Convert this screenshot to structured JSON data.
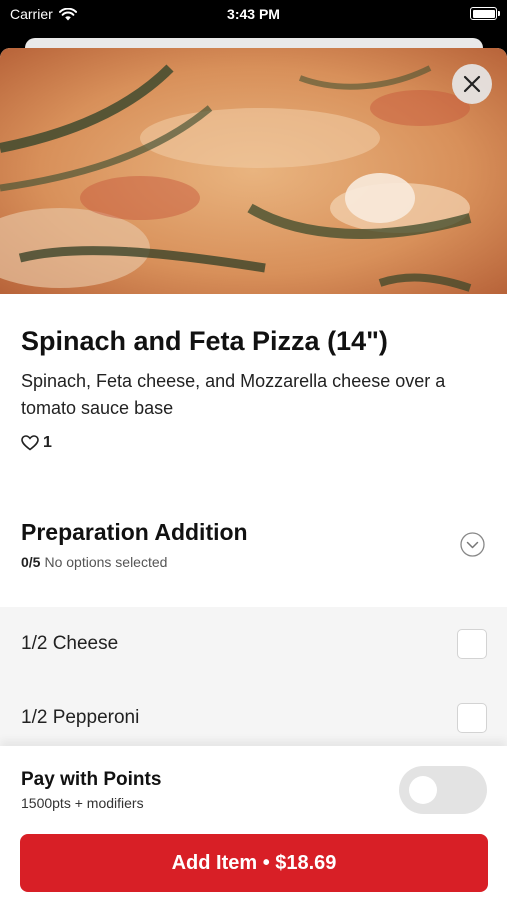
{
  "status_bar": {
    "carrier": "Carrier",
    "time": "3:43 PM"
  },
  "item": {
    "title": "Spinach and Feta Pizza (14\")",
    "description": "Spinach, Feta cheese, and Mozzarella cheese over a tomato sauce base",
    "like_count": "1"
  },
  "preparation": {
    "title": "Preparation Addition",
    "count": "0/5",
    "status": "No options selected",
    "options": [
      {
        "label": "1/2 Cheese",
        "checked": false
      },
      {
        "label": "1/2 Pepperoni",
        "checked": false
      }
    ]
  },
  "points": {
    "title": "Pay with Points",
    "subtitle": "1500pts + modifiers",
    "enabled": false
  },
  "cta": {
    "label": "Add Item • $18.69"
  },
  "icons": {
    "close": "close-icon",
    "chevron": "chevron-down-icon",
    "heart": "heart-icon",
    "wifi": "wifi-icon",
    "battery": "battery-icon"
  },
  "colors": {
    "accent": "#d81f26",
    "toggle_off": "#e3e3e3"
  }
}
